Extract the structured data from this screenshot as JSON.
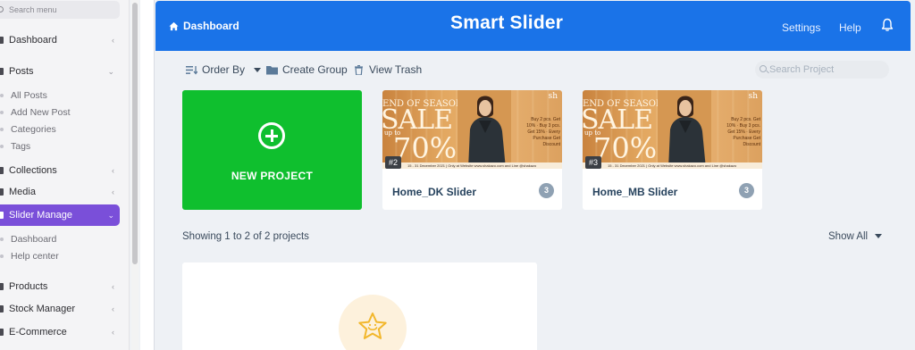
{
  "sidebar": {
    "search_placeholder": "Search menu",
    "items": [
      {
        "label": "Dashboard",
        "chevron": "‹"
      },
      {
        "label": "Posts",
        "chevron": "⌄"
      },
      {
        "label": "Collections",
        "chevron": "‹"
      },
      {
        "label": "Media",
        "chevron": "‹"
      },
      {
        "label": "Slider Manage",
        "chevron": "⌄"
      },
      {
        "label": "Products",
        "chevron": "‹"
      },
      {
        "label": "Stock Manager",
        "chevron": "‹"
      },
      {
        "label": "E-Commerce",
        "chevron": "‹"
      }
    ],
    "posts_sub": [
      "All Posts",
      "Add New Post",
      "Categories",
      "Tags"
    ],
    "slider_sub": [
      "Dashboard",
      "Help center"
    ],
    "active_color": "#7a4fd9"
  },
  "header": {
    "home_label": "Dashboard",
    "logo": "Smart Slider",
    "settings_label": "Settings",
    "help_label": "Help",
    "color": "#1a73e8"
  },
  "toolbar": {
    "order_by": "Order By",
    "create_group": "Create Group",
    "view_trash": "View Trash",
    "search_placeholder": "Search Project"
  },
  "new_project": {
    "label": "NEW PROJECT",
    "color": "#0fbf2e"
  },
  "projects": [
    {
      "badge": "#2",
      "title": "Home_DK Slider",
      "slides": "3",
      "thumb": {
        "eos": "END OF SEASON",
        "sale": "SALE",
        "upto": "up to",
        "pct": "70%",
        "promo": "Buy 2 pcs. Get 10% · Buy 3 pcs. Get 15% · Every Purchase Get Discount",
        "sh": "sh",
        "footer": "15 - 31 December 2021 | Only at Website www.shakazo.com and Line @shakazo"
      }
    },
    {
      "badge": "#3",
      "title": "Home_MB Slider",
      "slides": "3",
      "thumb": {
        "eos": "END OF SEASON",
        "sale": "SALE",
        "upto": "up to",
        "pct": "70%",
        "promo": "Buy 2 pcs. Get 10% · Buy 3 pcs. Get 15% · Every Purchase Get Discount",
        "sh": "sh",
        "footer": "15 - 31 December 2021 | Only at Website www.shakazo.com and Line @shakazo"
      }
    }
  ],
  "pagination": {
    "showing": "Showing 1 to 2 of 2 projects",
    "show_all": "Show All"
  },
  "icons": {
    "home": "home-icon",
    "bell": "bell-icon",
    "order": "sort-icon",
    "folder": "folder-icon",
    "trash": "trash-icon",
    "plus": "plus-circle-icon",
    "star": "star-icon"
  }
}
